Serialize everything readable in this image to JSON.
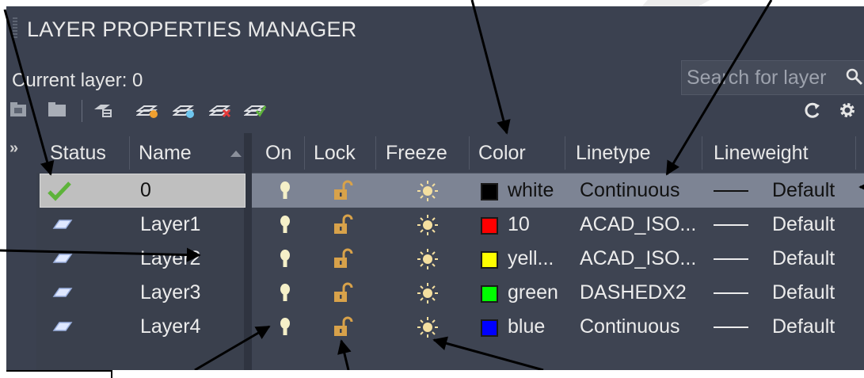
{
  "title": "LAYER PROPERTIES MANAGER",
  "current_layer": "Current layer: 0",
  "search": {
    "placeholder": "Search for layer"
  },
  "toolbar": {
    "left_icons": [
      "new-property-filter-icon",
      "new-group-filter-icon",
      "layer-states-manager-icon",
      "new-layer-icon",
      "new-layer-vp-frozen-icon",
      "delete-layer-icon",
      "set-current-icon"
    ],
    "right_icons": [
      "refresh-icon",
      "settings-icon"
    ]
  },
  "sidebar": {
    "expand_glyph": "»"
  },
  "columns": {
    "status": "Status",
    "name": "Name",
    "on": "On",
    "lock": "Lock",
    "freeze": "Freeze",
    "color": "Color",
    "linetype": "Linetype",
    "lineweight": "Lineweight"
  },
  "rows": [
    {
      "name": "0",
      "color_name": "white",
      "color_hex": "#000000",
      "linetype": "Continuous",
      "lineweight": "Default",
      "status": "current",
      "selected": true
    },
    {
      "name": "Layer1",
      "color_name": "10",
      "color_hex": "#ff0000",
      "linetype": "ACAD_ISO...",
      "lineweight": "Default",
      "status": "layer"
    },
    {
      "name": "Layer2",
      "color_name": "yell...",
      "color_hex": "#ffff00",
      "linetype": "ACAD_ISO...",
      "lineweight": "Default",
      "status": "layer"
    },
    {
      "name": "Layer3",
      "color_name": "green",
      "color_hex": "#00ff00",
      "linetype": "DASHEDX2",
      "lineweight": "Default",
      "status": "layer"
    },
    {
      "name": "Layer4",
      "color_name": "blue",
      "color_hex": "#0000ff",
      "linetype": "Continuous",
      "lineweight": "Default",
      "status": "layer"
    }
  ],
  "colors": {
    "panel": "#3b4150",
    "selected_row": "#7d8494",
    "check": "#5db33a",
    "lock": "#d8a24a"
  }
}
